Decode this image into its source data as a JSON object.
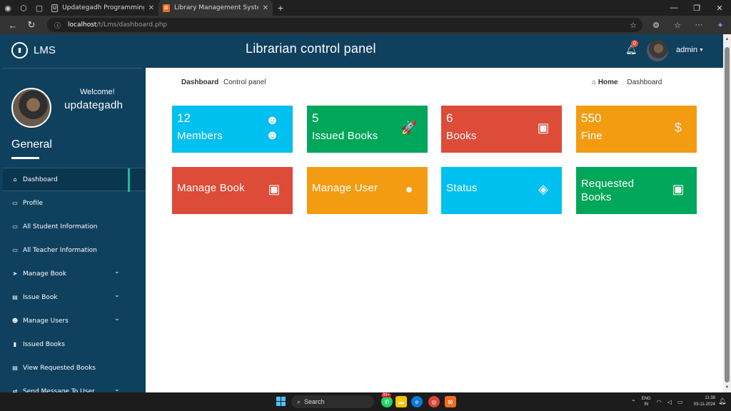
{
  "browser": {
    "tabs": [
      {
        "title": "Updategadh Programming - Upd",
        "icon": "updategadh-favicon",
        "active": false
      },
      {
        "title": "Library Management System",
        "icon": "xampp-favicon",
        "active": true
      }
    ],
    "new_tab": "+",
    "url_host": "localhost",
    "url_path": "/t/Lms/dashboard.php"
  },
  "app": {
    "brand": "LMS",
    "panel_title": "Librarian control panel",
    "notification_count": "0",
    "user_menu": "admin"
  },
  "sidebar": {
    "welcome": "Welcome!",
    "username": "updategadh",
    "section": "General",
    "items": [
      {
        "label": "Dashboard",
        "icon": "home-icon",
        "glyph": "⌂",
        "active": true,
        "dropdown": false
      },
      {
        "label": "Profile",
        "icon": "id-card-icon",
        "glyph": "▭",
        "active": false,
        "dropdown": false
      },
      {
        "label": "All Student Information",
        "icon": "monitor-icon",
        "glyph": "▭",
        "active": false,
        "dropdown": false
      },
      {
        "label": "All Teacher Information",
        "icon": "monitor-icon",
        "glyph": "▭",
        "active": false,
        "dropdown": false
      },
      {
        "label": "Manage Book",
        "icon": "send-icon",
        "glyph": "➤",
        "active": false,
        "dropdown": true
      },
      {
        "label": "Issue Book",
        "icon": "list-icon",
        "glyph": "▤",
        "active": false,
        "dropdown": true
      },
      {
        "label": "Manage Users",
        "icon": "users-icon",
        "glyph": "☻",
        "active": false,
        "dropdown": true
      },
      {
        "label": "Issued Books",
        "icon": "bookmark-icon",
        "glyph": "▮",
        "active": false,
        "dropdown": false
      },
      {
        "label": "View Requested Books",
        "icon": "list-icon",
        "glyph": "▤",
        "active": false,
        "dropdown": false
      },
      {
        "label": "Send Message To User",
        "icon": "exchange-icon",
        "glyph": "⇄",
        "active": false,
        "dropdown": true
      }
    ]
  },
  "breadcrumb": {
    "title": "Dashboard",
    "subtitle": "Control panel",
    "home": "Home",
    "current": "Dashboard"
  },
  "stats": [
    {
      "value": "12",
      "label": "Members",
      "icon": "users-icon",
      "glyph": "☻☻",
      "color": "#00c0ef"
    },
    {
      "value": "5",
      "label": "Issued Books",
      "icon": "rocket-icon",
      "glyph": "🚀",
      "color": "#00a65a"
    },
    {
      "value": "6",
      "label": "Books",
      "icon": "book-icon",
      "glyph": "▣",
      "color": "#dd4b39"
    },
    {
      "value": "550",
      "label": "Fine",
      "icon": "dollar-icon",
      "glyph": "$",
      "color": "#f39c12"
    }
  ],
  "actions": [
    {
      "label": "Manage Book",
      "icon": "book-icon",
      "glyph": "▣",
      "color": "#dd4b39"
    },
    {
      "label": "Manage User",
      "icon": "user-icon",
      "glyph": "●",
      "color": "#f39c12"
    },
    {
      "label": "Status",
      "icon": "layers-icon",
      "glyph": "◈",
      "color": "#00c0ef"
    },
    {
      "label": "Requested Books",
      "icon": "book-icon",
      "glyph": "▣",
      "color": "#00a65a"
    }
  ],
  "taskbar": {
    "search": "Search",
    "whatsapp_badge": "99+",
    "lang_top": "ENG",
    "lang_bottom": "IN",
    "time": "11:38",
    "date": "03-11-2024"
  }
}
